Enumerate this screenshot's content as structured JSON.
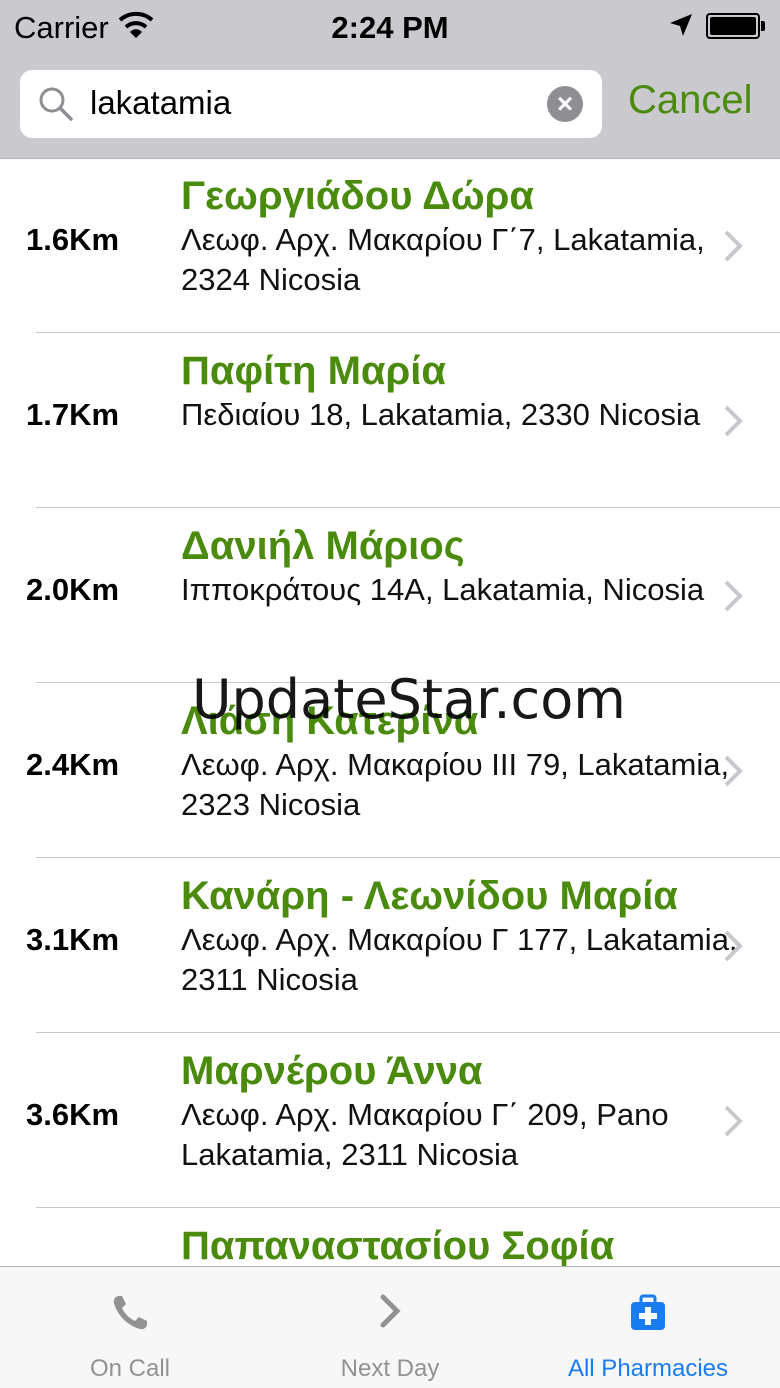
{
  "status": {
    "carrier": "Carrier",
    "time": "2:24 PM"
  },
  "search": {
    "query": "lakatamia",
    "cancel_label": "Cancel"
  },
  "pharmacies": [
    {
      "distance": "1.6Km",
      "name": "Γεωργιάδου Δώρα",
      "address": "Λεωφ. Αρχ. Μακαρίου Γ΄7, Lakatamia, 2324 Nicosia"
    },
    {
      "distance": "1.7Km",
      "name": "Παφίτη Μαρία",
      "address": "Πεδιαίου 18, Lakatamia, 2330 Nicosia"
    },
    {
      "distance": "2.0Km",
      "name": "Δανιήλ Μάριος",
      "address": "Ιπποκράτους 14Α, Lakatamia, Nicosia"
    },
    {
      "distance": "2.4Km",
      "name": "Λιάση Κατερίνα",
      "address": "Λεωφ. Αρχ. Μακαρίου ΙΙΙ 79, Lakatamia, 2323 Nicosia"
    },
    {
      "distance": "3.1Km",
      "name": "Κανάρη - Λεωνίδου Μαρία",
      "address": "Λεωφ. Αρχ. Μακαρίου Γ 177, Lakatamia, 2311 Nicosia"
    },
    {
      "distance": "3.6Km",
      "name": "Μαρνέρου Άννα",
      "address": "Λεωφ. Αρχ. Μακαρίου Γ΄ 209, Pano Lakatamia, 2311 Nicosia"
    },
    {
      "distance": "",
      "name": "Παπαναστασίου Σοφία",
      "address": ""
    }
  ],
  "watermark": "UpdateStar.com",
  "tabs": {
    "on_call": "On Call",
    "next_day": "Next Day",
    "all_pharmacies": "All Pharmacies"
  },
  "colors": {
    "accent_green": "#4a8a0c",
    "tab_selected": "#1a7cf3",
    "tab_unselected": "#929292"
  }
}
